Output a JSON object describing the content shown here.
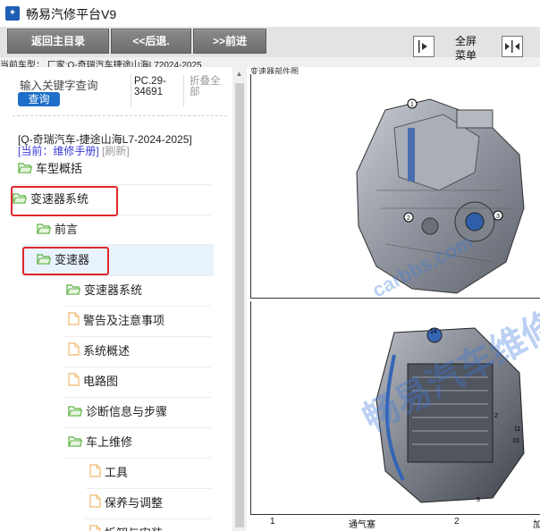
{
  "window": {
    "title": "畅易汽修平台V9"
  },
  "toolbar": {
    "back_main": "返回主目录",
    "back": "<<后退.",
    "forward": ">>前进",
    "fullscreen": "全屏",
    "menu": "菜单"
  },
  "vehicle_bar": "当前车型： 厂家:Q-奇瑞汽车捷途山海L72024-2025",
  "left_panel": {
    "search_placeholder": "输入关键字查询",
    "query_button": "查询",
    "code_line1": "PC.29-",
    "code_line2": "34691",
    "collapse_line1": "折叠全",
    "collapse_line2": "部",
    "book_title": "[Q-奇瑞汽车-捷途山海L7-2024-2025]",
    "current_label": "[当前：维修手册]",
    "refresh_label": "[刷新]",
    "tree": [
      {
        "label": "车型概括",
        "icon": "folder-open-icon"
      },
      {
        "label": "变速器系统",
        "icon": "folder-open-icon"
      },
      {
        "label": "前言",
        "icon": "folder-open-icon"
      },
      {
        "label": "变速器",
        "icon": "folder-open-icon"
      },
      {
        "label": "变速器系统",
        "icon": "folder-open-icon"
      },
      {
        "label": "警告及注意事项",
        "icon": "document-icon"
      },
      {
        "label": "系统概述",
        "icon": "document-icon"
      },
      {
        "label": "电路图",
        "icon": "document-icon"
      },
      {
        "label": "诊断信息与步骤",
        "icon": "folder-open-icon"
      },
      {
        "label": "车上维修",
        "icon": "folder-open-icon"
      },
      {
        "label": "工具",
        "icon": "document-icon"
      },
      {
        "label": "保养与调整",
        "icon": "document-icon"
      },
      {
        "label": "拆卸与安装",
        "icon": "document-icon"
      }
    ]
  },
  "document": {
    "header": "变速器部件图",
    "watermark_small": "carbbs.com",
    "watermark_big": "畅易汽车维修平台",
    "callouts_top": [
      "1",
      "2",
      "3"
    ],
    "callouts_bottom": [
      "14",
      "2",
      "11",
      "10",
      "9"
    ],
    "table_row": [
      "1",
      "通气塞",
      "2",
      "加"
    ]
  },
  "colors": {
    "highlight": "#e0272b",
    "accent_blue": "#1e6fc9",
    "folder_green": "#5cb040",
    "doc_orange": "#f0b86a"
  }
}
